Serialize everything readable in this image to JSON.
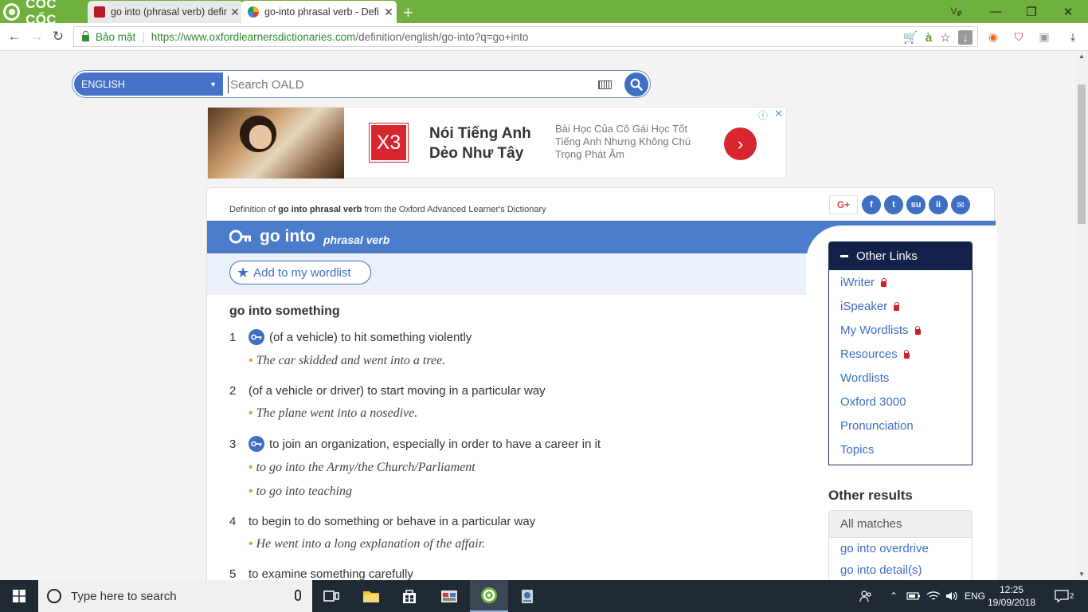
{
  "browser": {
    "brand": "CỐC CỐC",
    "tabs": [
      {
        "title": "go into (phrasal verb) defin",
        "active": false
      },
      {
        "title": "go-into phrasal verb - Defi",
        "active": true
      }
    ],
    "secure_label": "Bảo mật",
    "url_host": "https://www.oxfordlearnersdictionaries.com",
    "url_path": "/definition/english/go-into?q=go+into",
    "new_tab": "+",
    "win_min": "—",
    "win_max": "❐",
    "win_close": "✕"
  },
  "search": {
    "language": "ENGLISH",
    "placeholder": "Search OALD"
  },
  "ad": {
    "brand": "X3",
    "headline": "Nói Tiếng Anh Dẻo Như Tây",
    "description": "Bài Học Của Cô Gái Học Tốt Tiếng Anh Nhưng Không Chú Trọng Phát Âm"
  },
  "entry": {
    "definition_of_prefix": "Definition of",
    "definition_of_word": "go into phrasal verb",
    "definition_of_suffix": "from the Oxford Advanced Learner's Dictionary",
    "headword": "go into",
    "pos": "phrasal verb",
    "wordlist_button": "Add to my wordlist",
    "idiom": "go into something",
    "senses": [
      {
        "num": "1",
        "def": "(of a vehicle) to hit something violently",
        "key": true,
        "examples": [
          "The car skidded and went into a tree."
        ]
      },
      {
        "num": "2",
        "def": "(of a vehicle or driver) to start moving in a particular way",
        "key": false,
        "examples": [
          "The plane went into a nosedive."
        ]
      },
      {
        "num": "3",
        "def": "to join an organization, especially in order to have a career in it",
        "key": true,
        "examples": [
          "to go into the Army/the Church/Parliament",
          "to go into teaching"
        ]
      },
      {
        "num": "4",
        "def": "to begin to do something or behave in a particular way",
        "key": false,
        "examples": [
          "He went into a long explanation of the affair."
        ]
      },
      {
        "num": "5",
        "def": "to examine something carefully",
        "key": false,
        "examples": []
      }
    ]
  },
  "sidebar": {
    "other_links_title": "Other Links",
    "links": [
      {
        "label": "iWriter",
        "locked": true
      },
      {
        "label": "iSpeaker",
        "locked": true
      },
      {
        "label": "My Wordlists",
        "locked": true
      },
      {
        "label": "Resources",
        "locked": true
      },
      {
        "label": "Wordlists",
        "locked": false
      },
      {
        "label": "Oxford 3000",
        "locked": false
      },
      {
        "label": "Pronunciation",
        "locked": false
      },
      {
        "label": "Topics",
        "locked": false
      }
    ],
    "other_results_title": "Other results",
    "all_matches": "All matches",
    "matches": [
      "go into overdrive",
      "go into detail(s)"
    ]
  },
  "taskbar": {
    "search_placeholder": "Type here to search",
    "language": "ENG",
    "time": "12:25",
    "date": "19/09/2018",
    "notifications": "2"
  },
  "colors": {
    "brand_green": "#6fb13c",
    "oxford_blue": "#4a7ccb",
    "navy": "#13214a",
    "lock_red": "#cc2127"
  }
}
